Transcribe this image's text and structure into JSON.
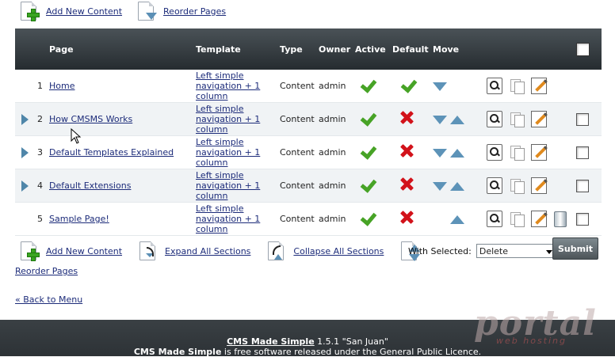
{
  "top_actions": {
    "add_new_content": "Add New Content",
    "reorder_pages": "Reorder Pages"
  },
  "table": {
    "headers": {
      "page": "Page",
      "template": "Template",
      "type": "Type",
      "owner": "Owner",
      "active": "Active",
      "default": "Default",
      "move": "Move"
    },
    "rows": [
      {
        "num": "1",
        "title": "Home",
        "template": "Left simple navigation + 1 column",
        "type": "Content",
        "owner": "admin",
        "active": true,
        "default": true,
        "expandable": false,
        "move_down": true,
        "move_up": false,
        "deletable": false,
        "selectable": false
      },
      {
        "num": "2",
        "title": "How CMSMS Works",
        "template": "Left simple navigation + 1 column",
        "type": "Content",
        "owner": "admin",
        "active": true,
        "default": false,
        "expandable": true,
        "move_down": true,
        "move_up": true,
        "deletable": false,
        "selectable": true
      },
      {
        "num": "3",
        "title": "Default Templates Explained",
        "template": "Left simple navigation + 1 column",
        "type": "Content",
        "owner": "admin",
        "active": true,
        "default": false,
        "expandable": true,
        "move_down": true,
        "move_up": true,
        "deletable": false,
        "selectable": true
      },
      {
        "num": "4",
        "title": "Default Extensions",
        "template": "Left simple navigation + 1 column",
        "type": "Content",
        "owner": "admin",
        "active": true,
        "default": false,
        "expandable": true,
        "move_down": true,
        "move_up": true,
        "deletable": false,
        "selectable": true
      },
      {
        "num": "5",
        "title": "Sample Page!",
        "template": "Left simple navigation + 1 column",
        "type": "Content",
        "owner": "admin",
        "active": true,
        "default": false,
        "expandable": false,
        "move_down": false,
        "move_up": true,
        "deletable": true,
        "selectable": true
      }
    ]
  },
  "bottom_actions": {
    "add_new_content": "Add New Content",
    "expand_all": "Expand All Sections",
    "collapse_all": "Collapse All Sections",
    "reorder_pages": "Reorder Pages"
  },
  "bulk": {
    "label": "With Selected:",
    "selected_option": "Delete",
    "submit": "Submit"
  },
  "back_link": "« Back to Menu",
  "footer": {
    "product": "CMS Made Simple",
    "version": "1.5.1 \"San Juan\"",
    "product2": "CMS Made Simple",
    "license": " is free software released under the General Public Licence."
  },
  "watermark": {
    "text": "portal",
    "subtext": "web hosting"
  },
  "colors": {
    "header_bg": "#2e3438",
    "check": "#47a326",
    "cross": "#d2121a",
    "arrow": "#5d93b8",
    "link": "#1d2c7a"
  }
}
